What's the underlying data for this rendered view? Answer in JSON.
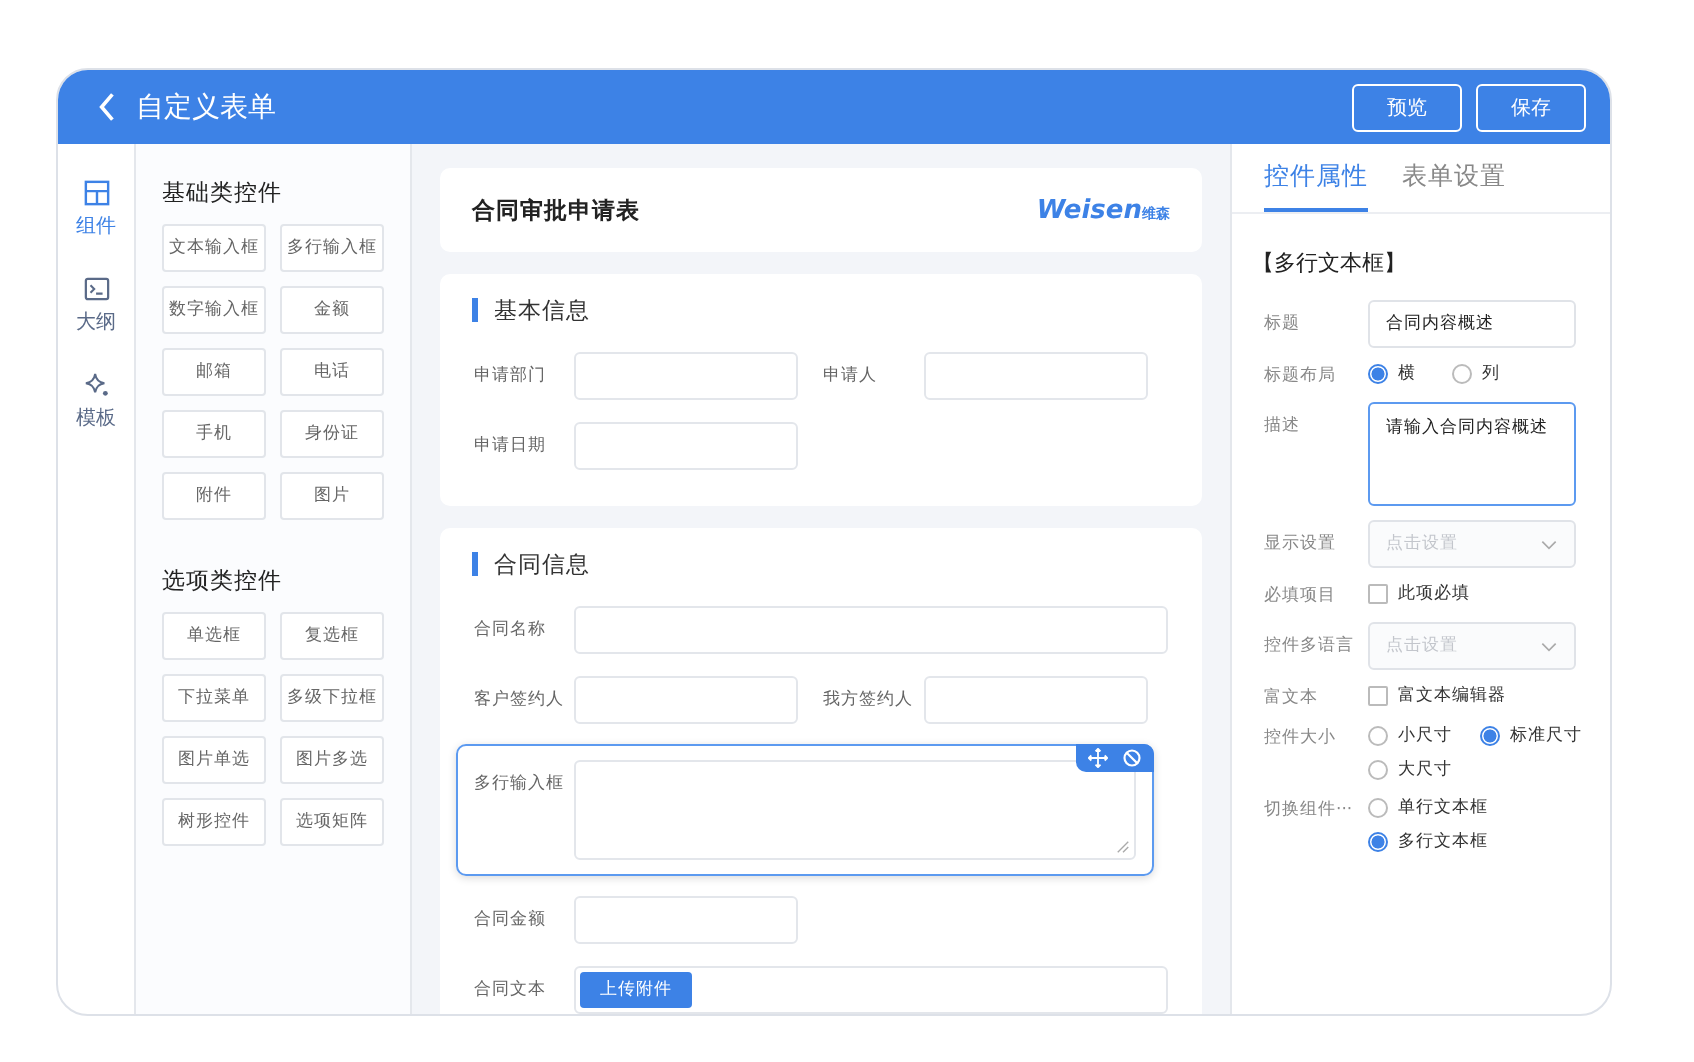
{
  "header": {
    "title": "自定义表单",
    "buttons": [
      "预览",
      "保存"
    ]
  },
  "rail": [
    {
      "label": "组件",
      "kind": "grid",
      "selected": true
    },
    {
      "label": "大纲",
      "kind": "terminal",
      "selected": false
    },
    {
      "label": "模板",
      "kind": "sparkle",
      "selected": false
    }
  ],
  "palette": [
    {
      "title": "基础类控件",
      "items": [
        "文本输入框",
        "多行输入框",
        "数字输入框",
        "金额",
        "邮箱",
        "电话",
        "手机",
        "身份证",
        "附件",
        "图片"
      ]
    },
    {
      "title": "选项类控件",
      "items": [
        "单选框",
        "复选框",
        "下拉菜单",
        "多级下拉框",
        "图片单选",
        "图片多选",
        "树形控件",
        "选项矩阵"
      ]
    }
  ],
  "form": {
    "title": "合同审批申请表",
    "logo": {
      "text": "Weisen",
      "suffix": "维森"
    },
    "sections": [
      {
        "title": "基本信息",
        "rows": [
          [
            {
              "label": "申请部门",
              "kind": "input",
              "selected": false
            },
            {
              "label": "申请人",
              "kind": "input",
              "selected": false
            }
          ],
          [
            {
              "label": "申请日期",
              "kind": "input",
              "selected": false
            }
          ]
        ]
      },
      {
        "title": "合同信息",
        "rows": [
          [
            {
              "label": "合同名称",
              "kind": "wide",
              "selected": false
            }
          ],
          [
            {
              "label": "客户签约人",
              "kind": "input",
              "selected": false
            },
            {
              "label": "我方签约人",
              "kind": "input",
              "selected": false
            }
          ],
          [
            {
              "label": "多行输入框",
              "kind": "textarea",
              "selected": true
            }
          ],
          [
            {
              "label": "合同金额",
              "kind": "input",
              "selected": false
            }
          ],
          [
            {
              "label": "合同文本",
              "kind": "upload",
              "button": "上传附件",
              "selected": false
            }
          ]
        ]
      }
    ]
  },
  "inspector": {
    "tabs": [
      {
        "label": "控件属性",
        "selected": true
      },
      {
        "label": "表单设置",
        "selected": false
      }
    ],
    "heading": "【多行文本框】",
    "props": [
      {
        "label": "标题",
        "kind": "text",
        "value": "合同内容概述"
      },
      {
        "label": "标题布局",
        "kind": "radio",
        "options": [
          {
            "label": "横",
            "selected": true
          },
          {
            "label": "列",
            "selected": false
          }
        ]
      },
      {
        "label": "描述",
        "kind": "textarea",
        "value": "请输入合同内容概述"
      },
      {
        "label": "显示设置",
        "kind": "select",
        "placeholder": "点击设置"
      },
      {
        "label": "必填项目",
        "kind": "checkbox",
        "option": "此项必填",
        "checked": false
      },
      {
        "label": "控件多语言",
        "kind": "select",
        "placeholder": "点击设置"
      },
      {
        "label": "富文本",
        "kind": "checkbox",
        "option": "富文本编辑器",
        "checked": false
      },
      {
        "label": "控件大小",
        "kind": "radio",
        "options": [
          {
            "label": "小尺寸",
            "selected": false
          },
          {
            "label": "标准尺寸",
            "selected": true
          },
          {
            "label": "大尺寸",
            "selected": false
          }
        ]
      },
      {
        "label": "切换组件···",
        "kind": "radio",
        "options": [
          {
            "label": "单行文本框",
            "selected": false
          },
          {
            "label": "多行文本框",
            "selected": true
          }
        ]
      }
    ]
  }
}
